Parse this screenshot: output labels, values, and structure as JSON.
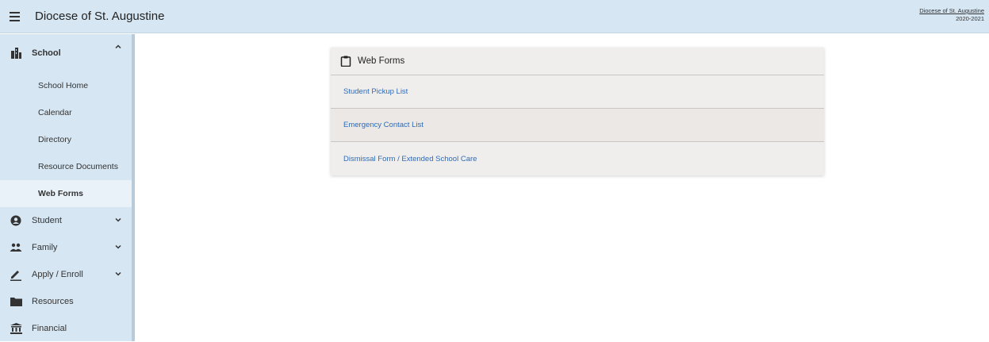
{
  "header": {
    "title": "Diocese of St. Augustine",
    "org_link": "Diocese of St. Augustine",
    "school_year": "2020-2021"
  },
  "sidebar": {
    "school": {
      "label": "School",
      "icon": "building-icon",
      "children": [
        {
          "label": "School Home"
        },
        {
          "label": "Calendar"
        },
        {
          "label": "Directory"
        },
        {
          "label": "Resource Documents"
        },
        {
          "label": "Web Forms",
          "active": true
        }
      ]
    },
    "items": [
      {
        "label": "Student",
        "icon": "user-circle-icon",
        "expandable": true
      },
      {
        "label": "Family",
        "icon": "people-icon",
        "expandable": true
      },
      {
        "label": "Apply / Enroll",
        "icon": "pencil-icon",
        "expandable": true
      },
      {
        "label": "Resources",
        "icon": "folder-icon",
        "expandable": false
      },
      {
        "label": "Financial",
        "icon": "bank-icon",
        "expandable": false
      }
    ]
  },
  "card": {
    "title": "Web Forms",
    "icon": "clipboard-icon",
    "links": [
      {
        "label": "Student Pickup List"
      },
      {
        "label": "Emergency Contact List"
      },
      {
        "label": "Dismissal Form / Extended School Care"
      }
    ]
  },
  "colors": {
    "sidebar_bg": "#d6e6f3",
    "link": "#2f6bb5",
    "card_bg": "#f0eeec"
  }
}
